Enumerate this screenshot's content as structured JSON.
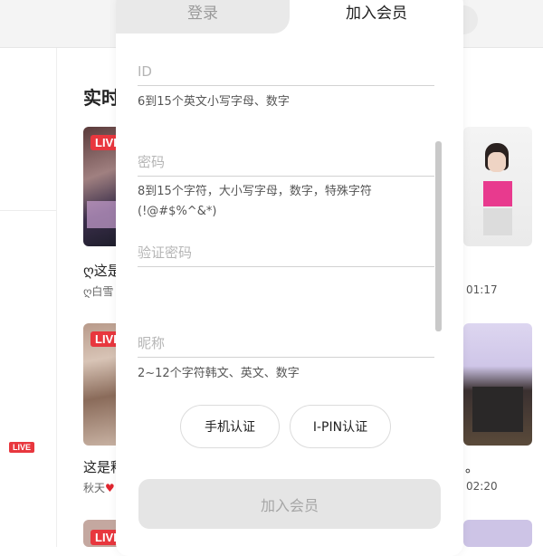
{
  "background": {
    "section_title": "实时",
    "live_badge": "LIVE",
    "cards": [
      {
        "title": "ღ这是",
        "sub": "ღ白雪"
      },
      {
        "title": "这是释",
        "sub": "秋天"
      }
    ],
    "right_card_suffix": "。",
    "times": [
      "01:17",
      "02:20"
    ]
  },
  "modal": {
    "tabs": {
      "login": "登录",
      "join": "加入会员"
    },
    "fields": {
      "id": {
        "placeholder": "ID",
        "hint": "6到15个英文小写字母、数字"
      },
      "password": {
        "placeholder": "密码",
        "hint": "8到15个字符，大小写字母，数字，特殊字符 (!@#$%^&*)"
      },
      "confirm_password": {
        "placeholder": "验证密码"
      },
      "nickname": {
        "placeholder": "昵称",
        "hint": "2~12个字符韩文、英文、数字"
      }
    },
    "buttons": {
      "phone_verify": "手机认证",
      "ipin_verify": "I-PIN认证",
      "submit": "加入会员"
    }
  },
  "colors": {
    "live_red": "#e8373e",
    "submit_bg": "#e5e5e5",
    "tab_inactive_bg": "#e9e9e9"
  }
}
